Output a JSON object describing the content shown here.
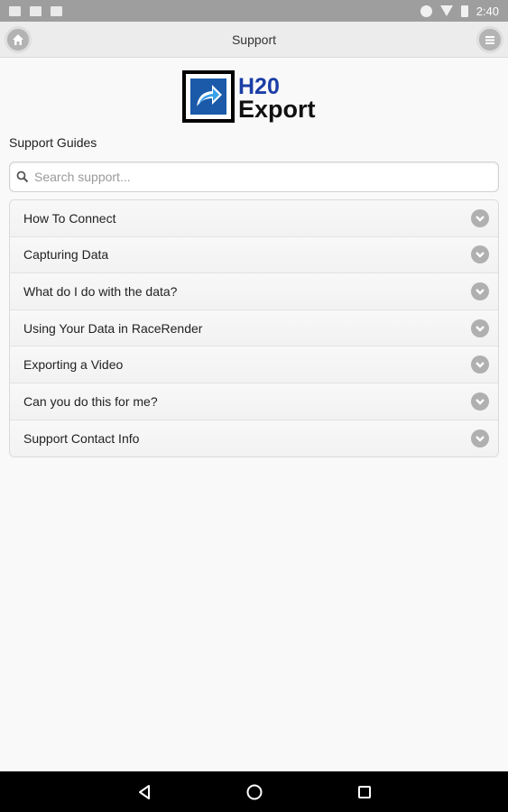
{
  "status_bar": {
    "time": "2:40"
  },
  "header": {
    "title": "Support",
    "home_icon": "home-icon",
    "menu_icon": "menu-icon"
  },
  "logo": {
    "line1": "H20",
    "line2": "Export",
    "color": "#1b3ea6"
  },
  "section_title": "Support Guides",
  "search": {
    "placeholder": "Search support..."
  },
  "support_items": [
    {
      "label": "How To Connect"
    },
    {
      "label": "Capturing Data"
    },
    {
      "label": "What do I do with the data?"
    },
    {
      "label": "Using Your Data in RaceRender"
    },
    {
      "label": "Exporting a Video"
    },
    {
      "label": "Can you do this for me?"
    },
    {
      "label": "Support Contact Info"
    }
  ]
}
